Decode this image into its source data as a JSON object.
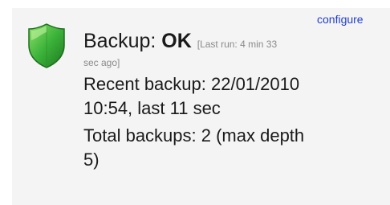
{
  "widget": {
    "configure_label": "configure",
    "status_prefix": "Backup: ",
    "status_value": "OK",
    "last_run_line1": "[Last run: 4 min 33",
    "last_run_line2": "sec ago]",
    "recent_line1": "Recent backup: 22/01/2010",
    "recent_line2": "10:54, last 11 sec",
    "total_line1": "Total backups: 2 (max depth",
    "total_line2": "5)",
    "status_icon": "green-shield-icon",
    "colors": {
      "panel_bg": "#f4f4f4",
      "link": "#1f3dcf",
      "shield_green": "#3cb33a",
      "muted_text": "#8a8a8a"
    }
  }
}
